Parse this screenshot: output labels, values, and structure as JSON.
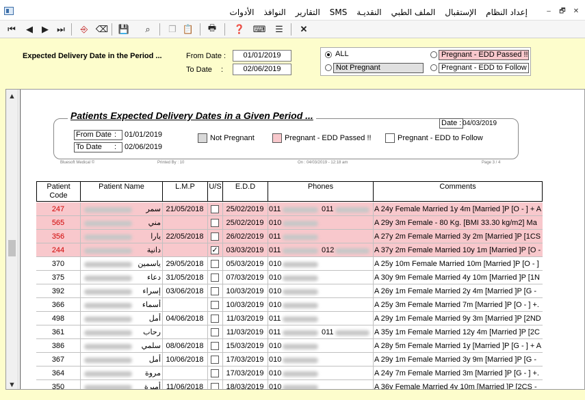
{
  "menu": [
    "إعداد النظام",
    "الإستقبال",
    "الملف الطبي",
    "النقديـة",
    "SMS",
    "التقارير",
    "النوافذ",
    "الأدوات"
  ],
  "window_controls": [
    "–",
    "🗗",
    "✕"
  ],
  "toolbar_icons": [
    "first-record-icon",
    "previous-record-icon",
    "next-record-icon",
    "last-record-icon",
    "exit-door-icon",
    "eraser-icon",
    "save-icon",
    "search-person-icon",
    "copy-icon",
    "paste-icon",
    "print-icon",
    "help-icon",
    "keyboard-icon",
    "notes-icon",
    "close-icon"
  ],
  "filter": {
    "title": "Expected Delivery Date in the Period ...",
    "from_label": "From Date :",
    "to_label": "To Date",
    "to_colon": ":",
    "from_value": "01/01/2019",
    "to_value": "02/06/2019",
    "opt_all": "ALL",
    "opt_not_pregnant": "Not Pregnant",
    "opt_edd_passed": "Pregnant - EDD Passed !!",
    "opt_edd_follow": "Pregnant - EDD to Follow"
  },
  "report": {
    "title": "Patients Expected Delivery Dates in a Given  Period ...",
    "date_label": "Date :",
    "date_value": "04/03/2019",
    "from_label": "From Date",
    "from_colon": ":",
    "from_value": "01/01/2019",
    "to_label": "To Date",
    "to_colon": ":",
    "to_value": "02/06/2019",
    "legend_not_pregnant": "Not Pregnant",
    "legend_passed": "Pregnant - EDD Passed !!",
    "legend_follow": "Pregnant - EDD to Follow",
    "footer_company": "Bluesoft Medical ©",
    "footer_printed_by": "Printed By :  10",
    "footer_on": "On :    04/03/2019  -  12:18 am",
    "footer_page": "Page  3  /  4"
  },
  "colors": {
    "pink_row": "#f8c8cc",
    "code_red": "#d00000",
    "panel_bg": "#fdfdcc"
  },
  "columns": [
    "Patient Code",
    "Patient Name",
    "L.M.P",
    "U/S",
    "E.D.D",
    "Phones",
    "Comments"
  ],
  "rows": [
    {
      "code": "247",
      "name": "سمر",
      "lmp": "21/05/2018",
      "us": false,
      "edd": "25/02/2019",
      "phone1": "011",
      "phone2": "011",
      "comment": "A 24y  Female   Married 1y 4m  [Married ]P [O - ] + A",
      "pink": true
    },
    {
      "code": "565",
      "name": "مني",
      "lmp": "",
      "us": false,
      "edd": "25/02/2019",
      "phone1": "010",
      "phone2": "",
      "comment": "A 29y 3m  Female  - 80 Kg.  [BMI 33.30 kg/m2]   Ma",
      "pink": true
    },
    {
      "code": "356",
      "name": "يارا",
      "lmp": "22/05/2018",
      "us": false,
      "edd": "26/02/2019",
      "phone1": "011",
      "phone2": "",
      "comment": "A 27y 2m  Female   Married 3y 2m  [Married ]P [1CS",
      "pink": true
    },
    {
      "code": "244",
      "name": "دانية",
      "lmp": "",
      "us": true,
      "edd": "03/03/2019",
      "phone1": "011",
      "phone2": "012",
      "comment": "A 37y 2m  Female   Married 10y 1m  [Married ]P [O -",
      "pink": true
    },
    {
      "code": "370",
      "name": "ياسمين",
      "lmp": "29/05/2018",
      "us": false,
      "edd": "05/03/2019",
      "phone1": "010",
      "phone2": "",
      "comment": "A 25y 10m  Female   Married 10m  [Married ]P [O - ]",
      "pink": false
    },
    {
      "code": "375",
      "name": "دعاء",
      "lmp": "31/05/2018",
      "us": false,
      "edd": "07/03/2019",
      "phone1": "010",
      "phone2": "",
      "comment": "A 30y 9m  Female   Married 4y 10m  [Married ]P [1N",
      "pink": false
    },
    {
      "code": "392",
      "name": "إسراء",
      "lmp": "03/06/2018",
      "us": false,
      "edd": "10/03/2019",
      "phone1": "010",
      "phone2": "",
      "comment": "A 26y 1m  Female   Married 2y 4m  [Married ]P [G -",
      "pink": false
    },
    {
      "code": "366",
      "name": "أسماء",
      "lmp": "",
      "us": false,
      "edd": "10/03/2019",
      "phone1": "010",
      "phone2": "",
      "comment": "A 25y 3m  Female   Married 7m  [Married ]P [O - ] +.",
      "pink": false
    },
    {
      "code": "498",
      "name": "أمل",
      "lmp": "04/06/2018",
      "us": false,
      "edd": "11/03/2019",
      "phone1": "011",
      "phone2": "",
      "comment": "A 29y 1m  Female   Married 9y 3m  [Married ]P [2ND",
      "pink": false
    },
    {
      "code": "361",
      "name": "رحاب",
      "lmp": "",
      "us": false,
      "edd": "11/03/2019",
      "phone1": "011",
      "phone2": "011",
      "comment": "A 35y 1m  Female   Married 12y 4m  [Married ]P [2C",
      "pink": false
    },
    {
      "code": "386",
      "name": "سلمي",
      "lmp": "08/06/2018",
      "us": false,
      "edd": "15/03/2019",
      "phone1": "010",
      "phone2": "",
      "comment": "A 28y 5m  Female   Married 1y  [Married ]P [G - ] + A",
      "pink": false
    },
    {
      "code": "367",
      "name": "أمل",
      "lmp": "10/06/2018",
      "us": false,
      "edd": "17/03/2019",
      "phone1": "010",
      "phone2": "",
      "comment": "A 29y 1m  Female   Married 3y 9m  [Married ]P [G -",
      "pink": false
    },
    {
      "code": "364",
      "name": "مروة",
      "lmp": "",
      "us": false,
      "edd": "17/03/2019",
      "phone1": "010",
      "phone2": "",
      "comment": "A 24y 7m  Female   Married 3m  [Married ]P [G - ] +.",
      "pink": false
    },
    {
      "code": "350",
      "name": "أميرة",
      "lmp": "11/06/2018",
      "us": false,
      "edd": "18/03/2019",
      "phone1": "010",
      "phone2": "",
      "comment": "A 36y  Female   Married 4y 10m  [Married ]P [2CS -",
      "pink": false
    }
  ]
}
